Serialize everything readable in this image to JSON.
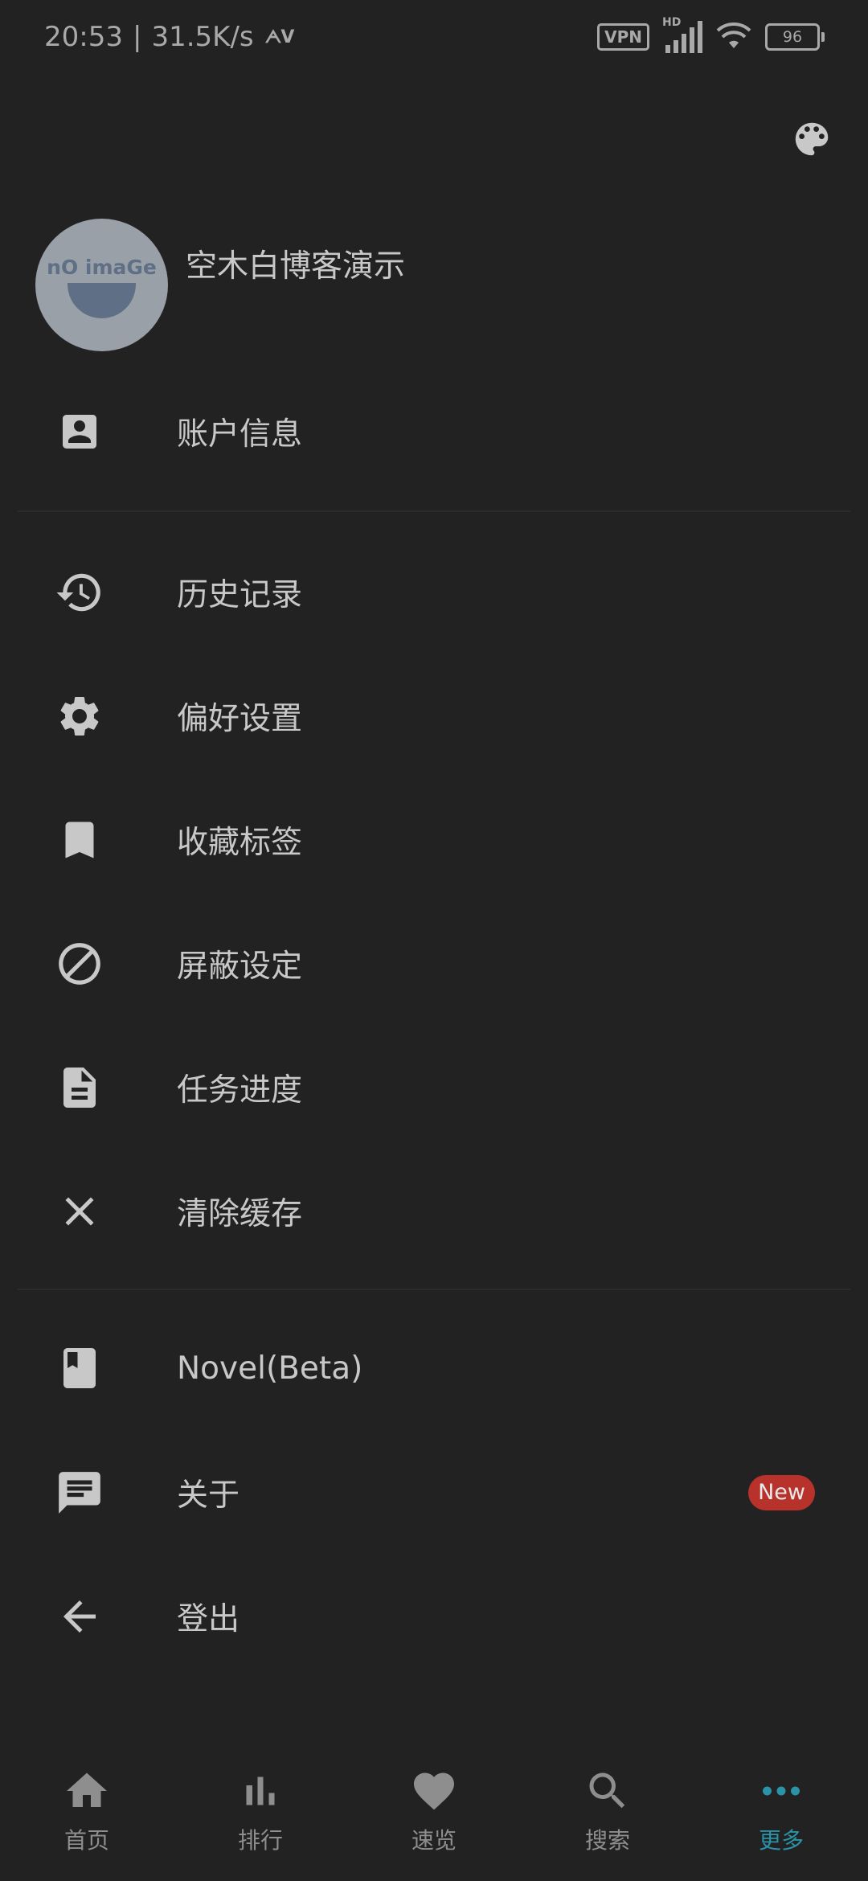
{
  "status_bar": {
    "time": "20:53",
    "speed": "31.5K/s",
    "vpn_label": "VPN",
    "hd_label": "HD",
    "battery": "96"
  },
  "profile": {
    "avatar_text": "nO imaGe",
    "username": "空木白博客演示"
  },
  "menu": {
    "account": "账户信息",
    "history": "历史记录",
    "preferences": "偏好设置",
    "bookmarks": "收藏标签",
    "block": "屏蔽设定",
    "tasks": "任务进度",
    "clear_cache": "清除缓存",
    "novel": "Novel(Beta)",
    "about": "关于",
    "about_badge": "New",
    "logout": "登出"
  },
  "bottom_nav": {
    "home": "首页",
    "ranking": "排行",
    "browse": "速览",
    "search": "搜索",
    "more": "更多"
  },
  "colors": {
    "background": "#222222",
    "text": "#c8c8c8",
    "accent": "#2a93a8",
    "badge": "#b8322c"
  }
}
